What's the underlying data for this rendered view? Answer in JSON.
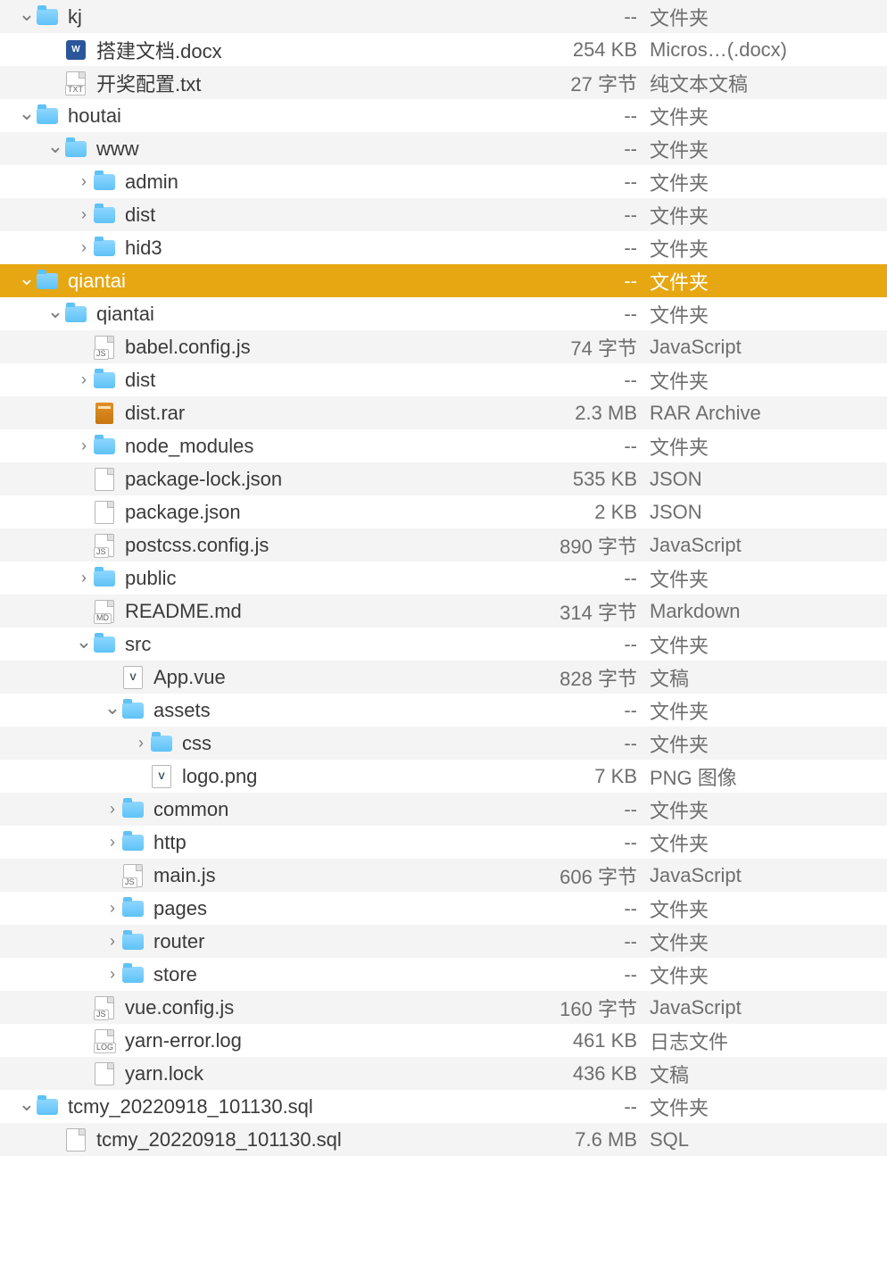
{
  "rows": [
    {
      "depth": 1,
      "arrow": "down",
      "icon": "folder",
      "name": "kj",
      "size": "--",
      "kind": "文件夹"
    },
    {
      "depth": 2,
      "arrow": "",
      "icon": "docx",
      "name": "搭建文档.docx",
      "size": "254 KB",
      "kind": "Micros…(.docx)"
    },
    {
      "depth": 2,
      "arrow": "",
      "icon": "txt",
      "name": "开奖配置.txt",
      "size": "27 字节",
      "kind": "纯文本文稿"
    },
    {
      "depth": 1,
      "arrow": "down",
      "icon": "folder",
      "name": "houtai",
      "size": "--",
      "kind": "文件夹"
    },
    {
      "depth": 2,
      "arrow": "down",
      "icon": "folder",
      "name": "www",
      "size": "--",
      "kind": "文件夹"
    },
    {
      "depth": 3,
      "arrow": "right",
      "icon": "folder",
      "name": "admin",
      "size": "--",
      "kind": "文件夹"
    },
    {
      "depth": 3,
      "arrow": "right",
      "icon": "folder",
      "name": "dist",
      "size": "--",
      "kind": "文件夹"
    },
    {
      "depth": 3,
      "arrow": "right",
      "icon": "folder",
      "name": "hid3",
      "size": "--",
      "kind": "文件夹"
    },
    {
      "depth": 1,
      "arrow": "down",
      "icon": "folder",
      "name": "qiantai",
      "size": "--",
      "kind": "文件夹",
      "selected": true
    },
    {
      "depth": 2,
      "arrow": "down",
      "icon": "folder",
      "name": "qiantai",
      "size": "--",
      "kind": "文件夹"
    },
    {
      "depth": 3,
      "arrow": "",
      "icon": "js",
      "name": "babel.config.js",
      "size": "74 字节",
      "kind": "JavaScript"
    },
    {
      "depth": 3,
      "arrow": "right",
      "icon": "folder",
      "name": "dist",
      "size": "--",
      "kind": "文件夹"
    },
    {
      "depth": 3,
      "arrow": "",
      "icon": "rar",
      "name": "dist.rar",
      "size": "2.3 MB",
      "kind": "RAR Archive"
    },
    {
      "depth": 3,
      "arrow": "right",
      "icon": "folder",
      "name": "node_modules",
      "size": "--",
      "kind": "文件夹"
    },
    {
      "depth": 3,
      "arrow": "",
      "icon": "doc",
      "name": "package-lock.json",
      "size": "535 KB",
      "kind": "JSON"
    },
    {
      "depth": 3,
      "arrow": "",
      "icon": "doc",
      "name": "package.json",
      "size": "2 KB",
      "kind": "JSON"
    },
    {
      "depth": 3,
      "arrow": "",
      "icon": "js",
      "name": "postcss.config.js",
      "size": "890 字节",
      "kind": "JavaScript"
    },
    {
      "depth": 3,
      "arrow": "right",
      "icon": "folder",
      "name": "public",
      "size": "--",
      "kind": "文件夹"
    },
    {
      "depth": 3,
      "arrow": "",
      "icon": "md",
      "name": "README.md",
      "size": "314 字节",
      "kind": "Markdown"
    },
    {
      "depth": 3,
      "arrow": "down",
      "icon": "folder",
      "name": "src",
      "size": "--",
      "kind": "文件夹"
    },
    {
      "depth": 4,
      "arrow": "",
      "icon": "vue",
      "name": "App.vue",
      "size": "828 字节",
      "kind": "文稿"
    },
    {
      "depth": 4,
      "arrow": "down",
      "icon": "folder",
      "name": "assets",
      "size": "--",
      "kind": "文件夹"
    },
    {
      "depth": 5,
      "arrow": "right",
      "icon": "folder",
      "name": "css",
      "size": "--",
      "kind": "文件夹"
    },
    {
      "depth": 5,
      "arrow": "",
      "icon": "vue",
      "name": "logo.png",
      "size": "7 KB",
      "kind": "PNG 图像"
    },
    {
      "depth": 4,
      "arrow": "right",
      "icon": "folder",
      "name": "common",
      "size": "--",
      "kind": "文件夹"
    },
    {
      "depth": 4,
      "arrow": "right",
      "icon": "folder",
      "name": "http",
      "size": "--",
      "kind": "文件夹"
    },
    {
      "depth": 4,
      "arrow": "",
      "icon": "js",
      "name": "main.js",
      "size": "606 字节",
      "kind": "JavaScript"
    },
    {
      "depth": 4,
      "arrow": "right",
      "icon": "folder",
      "name": "pages",
      "size": "--",
      "kind": "文件夹"
    },
    {
      "depth": 4,
      "arrow": "right",
      "icon": "folder",
      "name": "router",
      "size": "--",
      "kind": "文件夹"
    },
    {
      "depth": 4,
      "arrow": "right",
      "icon": "folder",
      "name": "store",
      "size": "--",
      "kind": "文件夹"
    },
    {
      "depth": 3,
      "arrow": "",
      "icon": "js",
      "name": "vue.config.js",
      "size": "160 字节",
      "kind": "JavaScript"
    },
    {
      "depth": 3,
      "arrow": "",
      "icon": "log",
      "name": "yarn-error.log",
      "size": "461 KB",
      "kind": "日志文件"
    },
    {
      "depth": 3,
      "arrow": "",
      "icon": "doc",
      "name": "yarn.lock",
      "size": "436 KB",
      "kind": "文稿"
    },
    {
      "depth": 1,
      "arrow": "down",
      "icon": "folder",
      "name": "tcmy_20220918_101130.sql",
      "size": "--",
      "kind": "文件夹"
    },
    {
      "depth": 2,
      "arrow": "",
      "icon": "doc",
      "name": "tcmy_20220918_101130.sql",
      "size": "7.6 MB",
      "kind": "SQL"
    }
  ],
  "glyphs": {
    "down": "⌄",
    "right": "›",
    "none": ""
  }
}
